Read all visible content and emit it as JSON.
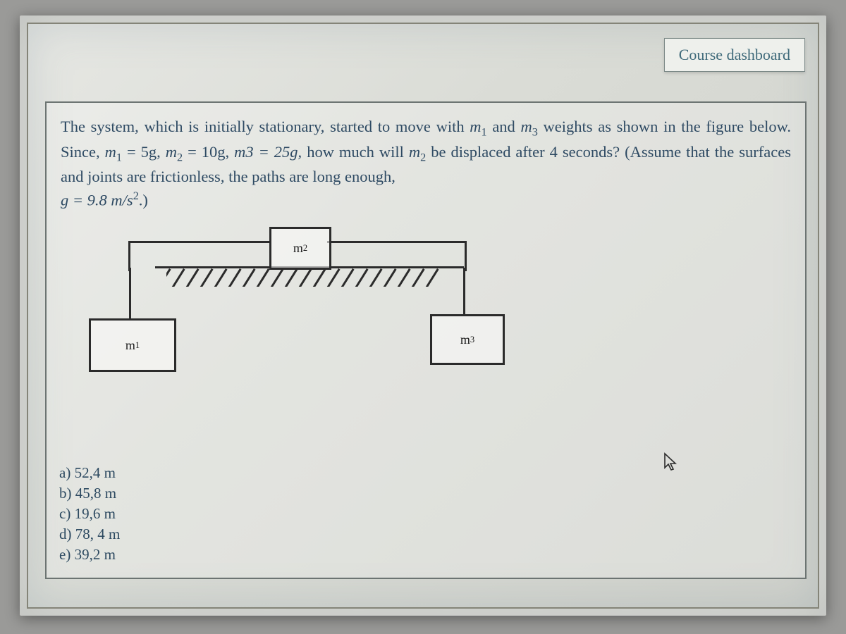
{
  "header": {
    "dashboard_label": "Course dashboard"
  },
  "question": {
    "text_plain": "The system, which is initially stationary, started to move with m1 and m3 weights as shown in the figure below. Since, m1 = 5g, m2 = 10g, m3 = 25g, how much will m2 be displaced after 4 seconds? (Assume that the surfaces and joints are frictionless, the paths are long enough, g = 9.8 m/s².)",
    "segments": {
      "s1": "The system, which is initially stationary, started to move with ",
      "m1": "m",
      "m1_sub": "1",
      "s2": " and ",
      "m3": "m",
      "m3_sub": "3",
      "s3": " weights as shown in the figure below. Since, ",
      "eq1_l": "m",
      "eq1_sub": "1",
      "eq1_r": " = 5g, ",
      "eq2_l": "m",
      "eq2_sub": "2",
      "eq2_r": " = 10g, ",
      "eq3_l": "m3 = 25g, ",
      "s4": "how much will ",
      "m2": "m",
      "m2_sub": "2",
      "s5": " be displaced after 4 seconds? (Assume that the surfaces and joints are frictionless, the paths are long enough,",
      "g_line_l": "g = 9.8 m/s",
      "g_sup": "2",
      "g_line_r": ".)"
    },
    "figure_labels": {
      "m1": "m",
      "m1_sub": "1",
      "m2": "m",
      "m2_sub": "2",
      "m3": "m",
      "m3_sub": "3"
    },
    "options": {
      "a": "a) 52,4 m",
      "b": "b) 45,8 m",
      "c": "c) 19,6 m",
      "d": "d) 78, 4 m",
      "e": "e) 39,2 m"
    }
  },
  "given": {
    "m1_g": 5,
    "m2_g": 10,
    "m3_g": 25,
    "time_s": 4,
    "g": 9.8,
    "units": "m/s^2"
  }
}
